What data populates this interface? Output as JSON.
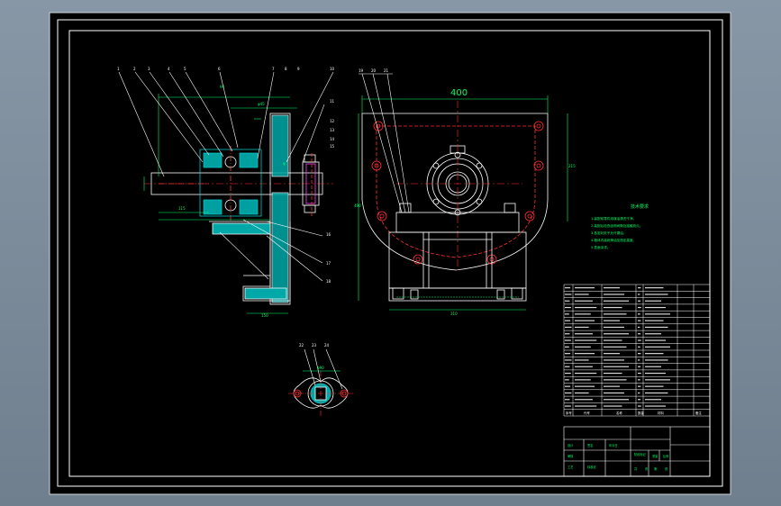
{
  "drawing": {
    "dimension_top": "400",
    "tech_title": "技术要求",
    "tech_lines": [
      "1.装配前零件用煤油清洗干净。",
      "2.装配后检查齿侧间隙及接触斑点。",
      "3.各密封处不允许漏油。",
      "4.箱体内装润滑油至规定高度。",
      "5.表面涂漆。"
    ],
    "part_callouts_left": [
      "1",
      "2",
      "3",
      "4",
      "5",
      "6",
      "7",
      "8",
      "9",
      "10"
    ],
    "part_callouts_right": [
      "19",
      "20",
      "21"
    ],
    "part_callouts_bottom": [
      "22",
      "23",
      "24"
    ],
    "bom_headers": [
      "序号",
      "代号",
      "名称",
      "数量",
      "材料",
      "备注"
    ],
    "colors": {
      "background": "#000000",
      "frame": "#ffffff",
      "outline": "#ffffff",
      "hidden": "#ff3030",
      "dimension": "#00ff66",
      "section": "#00c8c8",
      "magenta": "#ff40ff",
      "title_text": "#00ff66"
    }
  }
}
